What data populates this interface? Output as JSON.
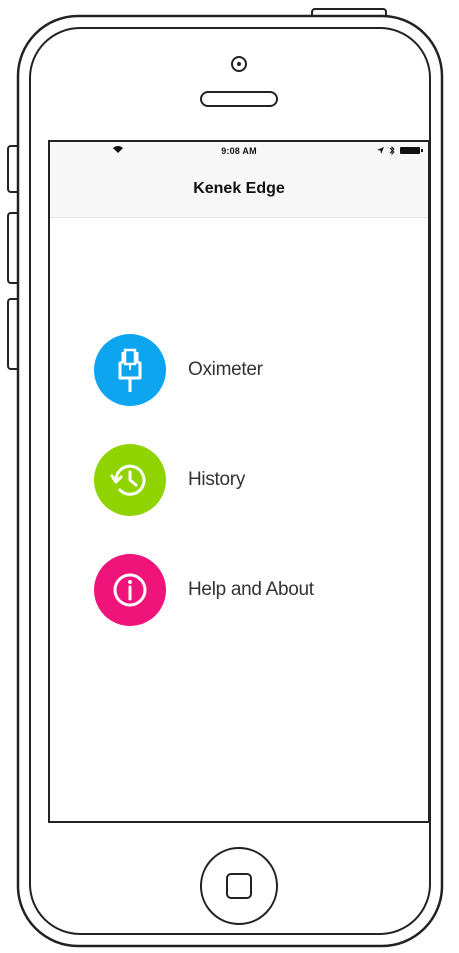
{
  "status_bar": {
    "time": "9:08 AM",
    "left_icon": "wifi-icon",
    "right_icons": [
      "location-icon",
      "bluetooth-icon",
      "battery-icon"
    ]
  },
  "nav": {
    "title": "Kenek Edge"
  },
  "menu": {
    "items": [
      {
        "label": "Oximeter",
        "icon": "oximeter-clip-icon",
        "color": "#0ea5f0"
      },
      {
        "label": "History",
        "icon": "history-clock-icon",
        "color": "#8fd400"
      },
      {
        "label": "Help and About",
        "icon": "info-icon",
        "color": "#f0137a"
      }
    ]
  },
  "device": {
    "home_button": "home-button"
  }
}
